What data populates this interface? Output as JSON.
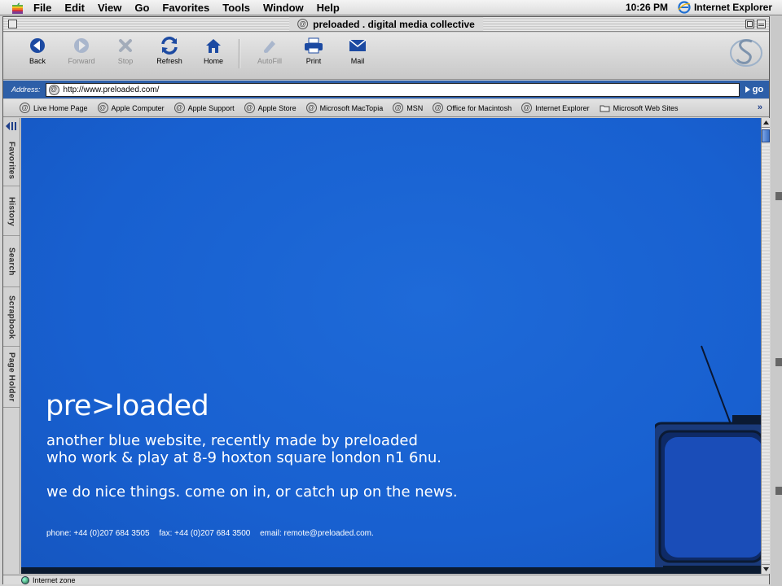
{
  "menubar": {
    "items": [
      "File",
      "Edit",
      "View",
      "Go",
      "Favorites",
      "Tools",
      "Window",
      "Help"
    ],
    "clock": "10:26 PM",
    "app_name": "Internet Explorer"
  },
  "window": {
    "title": "preloaded . digital media collective"
  },
  "toolbar": {
    "buttons": [
      {
        "label": "Back",
        "icon": "back-arrow-icon",
        "enabled": true
      },
      {
        "label": "Forward",
        "icon": "forward-arrow-icon",
        "enabled": false
      },
      {
        "label": "Stop",
        "icon": "stop-icon",
        "enabled": false
      },
      {
        "label": "Refresh",
        "icon": "refresh-icon",
        "enabled": true
      },
      {
        "label": "Home",
        "icon": "home-icon",
        "enabled": true
      },
      {
        "label": "AutoFill",
        "icon": "autofill-icon",
        "enabled": false
      },
      {
        "label": "Print",
        "icon": "print-icon",
        "enabled": true
      },
      {
        "label": "Mail",
        "icon": "mail-icon",
        "enabled": true
      }
    ]
  },
  "address": {
    "label": "Address:",
    "url": "http://www.preloaded.com/",
    "go_label": "go"
  },
  "favorites": [
    "Live Home Page",
    "Apple Computer",
    "Apple Support",
    "Apple Store",
    "Microsoft MacTopia",
    "MSN",
    "Office for Macintosh",
    "Internet Explorer",
    "Microsoft Web Sites"
  ],
  "sidebar": {
    "tabs": [
      "Favorites",
      "History",
      "Search",
      "Scrapbook",
      "Page Holder"
    ]
  },
  "page": {
    "logo": "pre>loaded",
    "line1": "another blue website, recently made by preloaded",
    "line2": "who work & play at 8-9 hoxton square london n1 6nu.",
    "line3": "we do nice things. come on in, or catch up on the news.",
    "phone": "phone: +44 (0)207 684 3505",
    "fax": "fax: +44 (0)207 684 3500",
    "email": "email: remote@preloaded.com.",
    "background_color": "#1860d0"
  },
  "status": {
    "zone": "Internet zone"
  }
}
